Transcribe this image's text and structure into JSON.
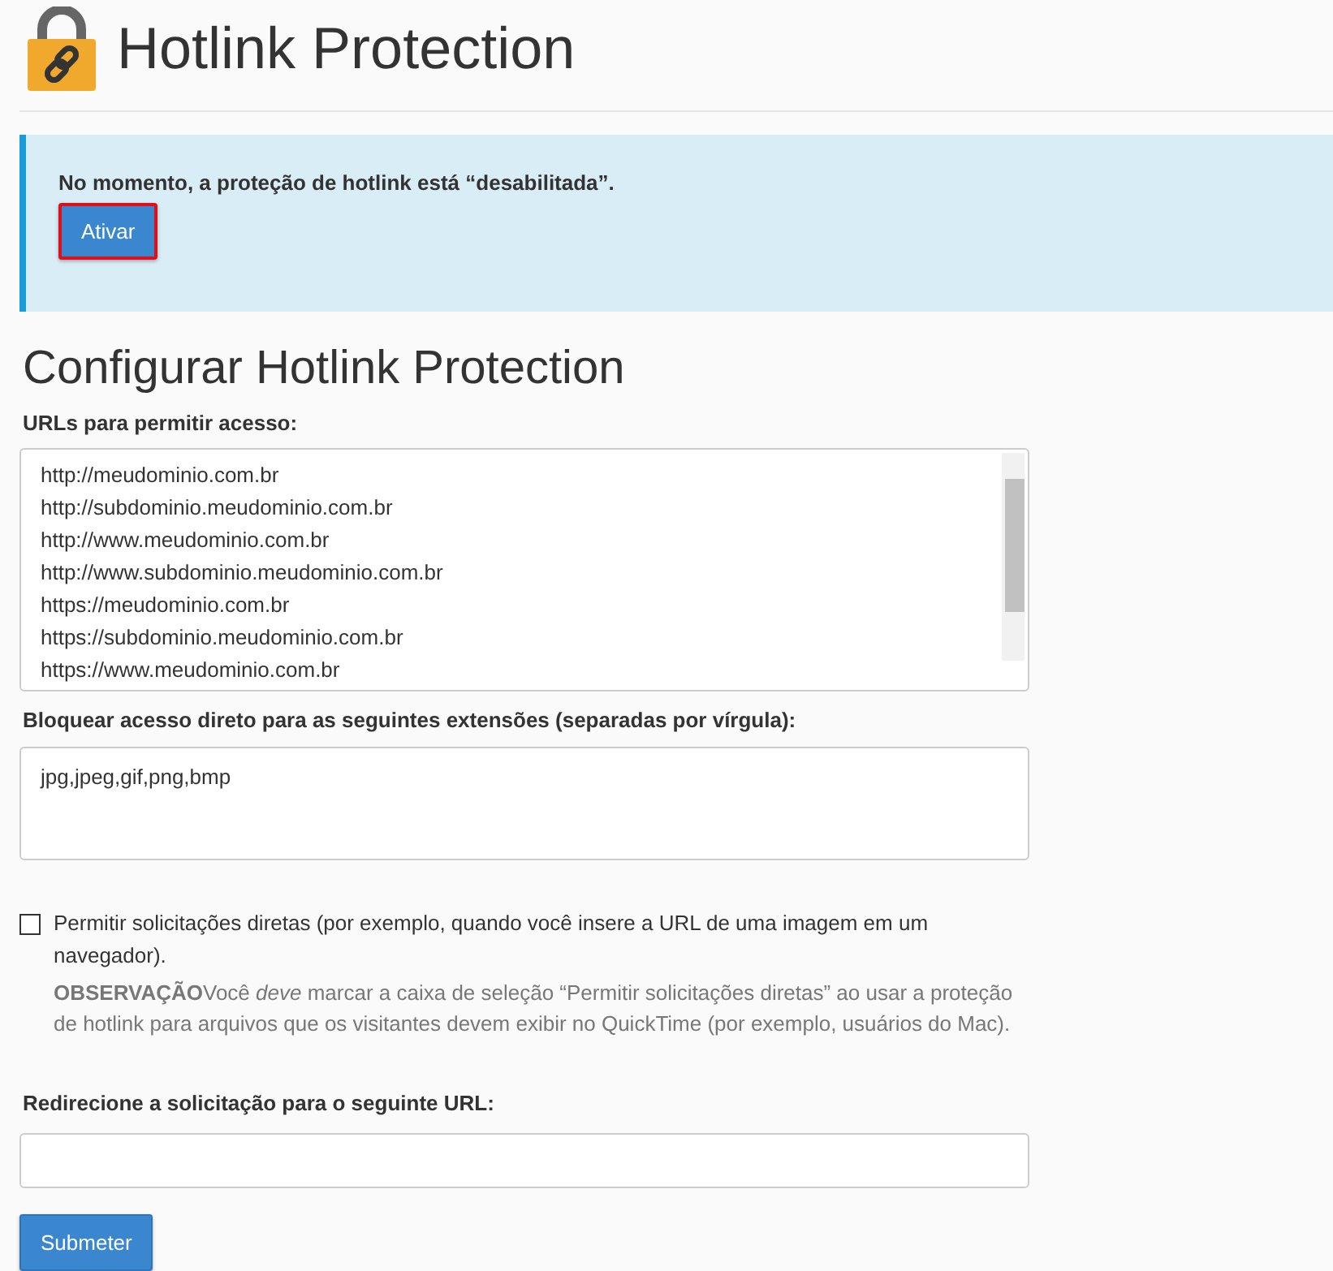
{
  "page_title": "Hotlink Protection",
  "alert": {
    "message": "No momento, a proteção de hotlink está “desabilitada”.",
    "button": {
      "label": "Ativar",
      "focused": true
    }
  },
  "section_title": "Configurar Hotlink Protection",
  "allowed_urls": {
    "label": "URLs para permitir acesso:",
    "lines": [
      "http://meudominio.com.br",
      "http://subdominio.meudominio.com.br",
      "http://www.meudominio.com.br",
      "http://www.subdominio.meudominio.com.br",
      "https://meudominio.com.br",
      "https://subdominio.meudominio.com.br",
      "https://www.meudominio.com.br"
    ]
  },
  "extensions": {
    "label": "Bloquear acesso direto para as seguintes extensões (separadas por vírgula):",
    "value": "jpg,jpeg,gif,png,bmp"
  },
  "direct_requests": {
    "label": "Permitir solicitações diretas (por exemplo, quando você insere a URL de uma imagem em um navegador).",
    "checked": false,
    "note": "**OBSERVAÇÃO**Você *deve* marcar a caixa de seleção “Permitir solicitações diretas” ao usar a proteção de hotlink para arquivos que os visitantes devem exibir no QuickTime (por exemplo, usuários do Mac)."
  },
  "redirect": {
    "label": "Redirecione a solicitação para o seguinte URL:"
  },
  "submit": "Submeter"
}
